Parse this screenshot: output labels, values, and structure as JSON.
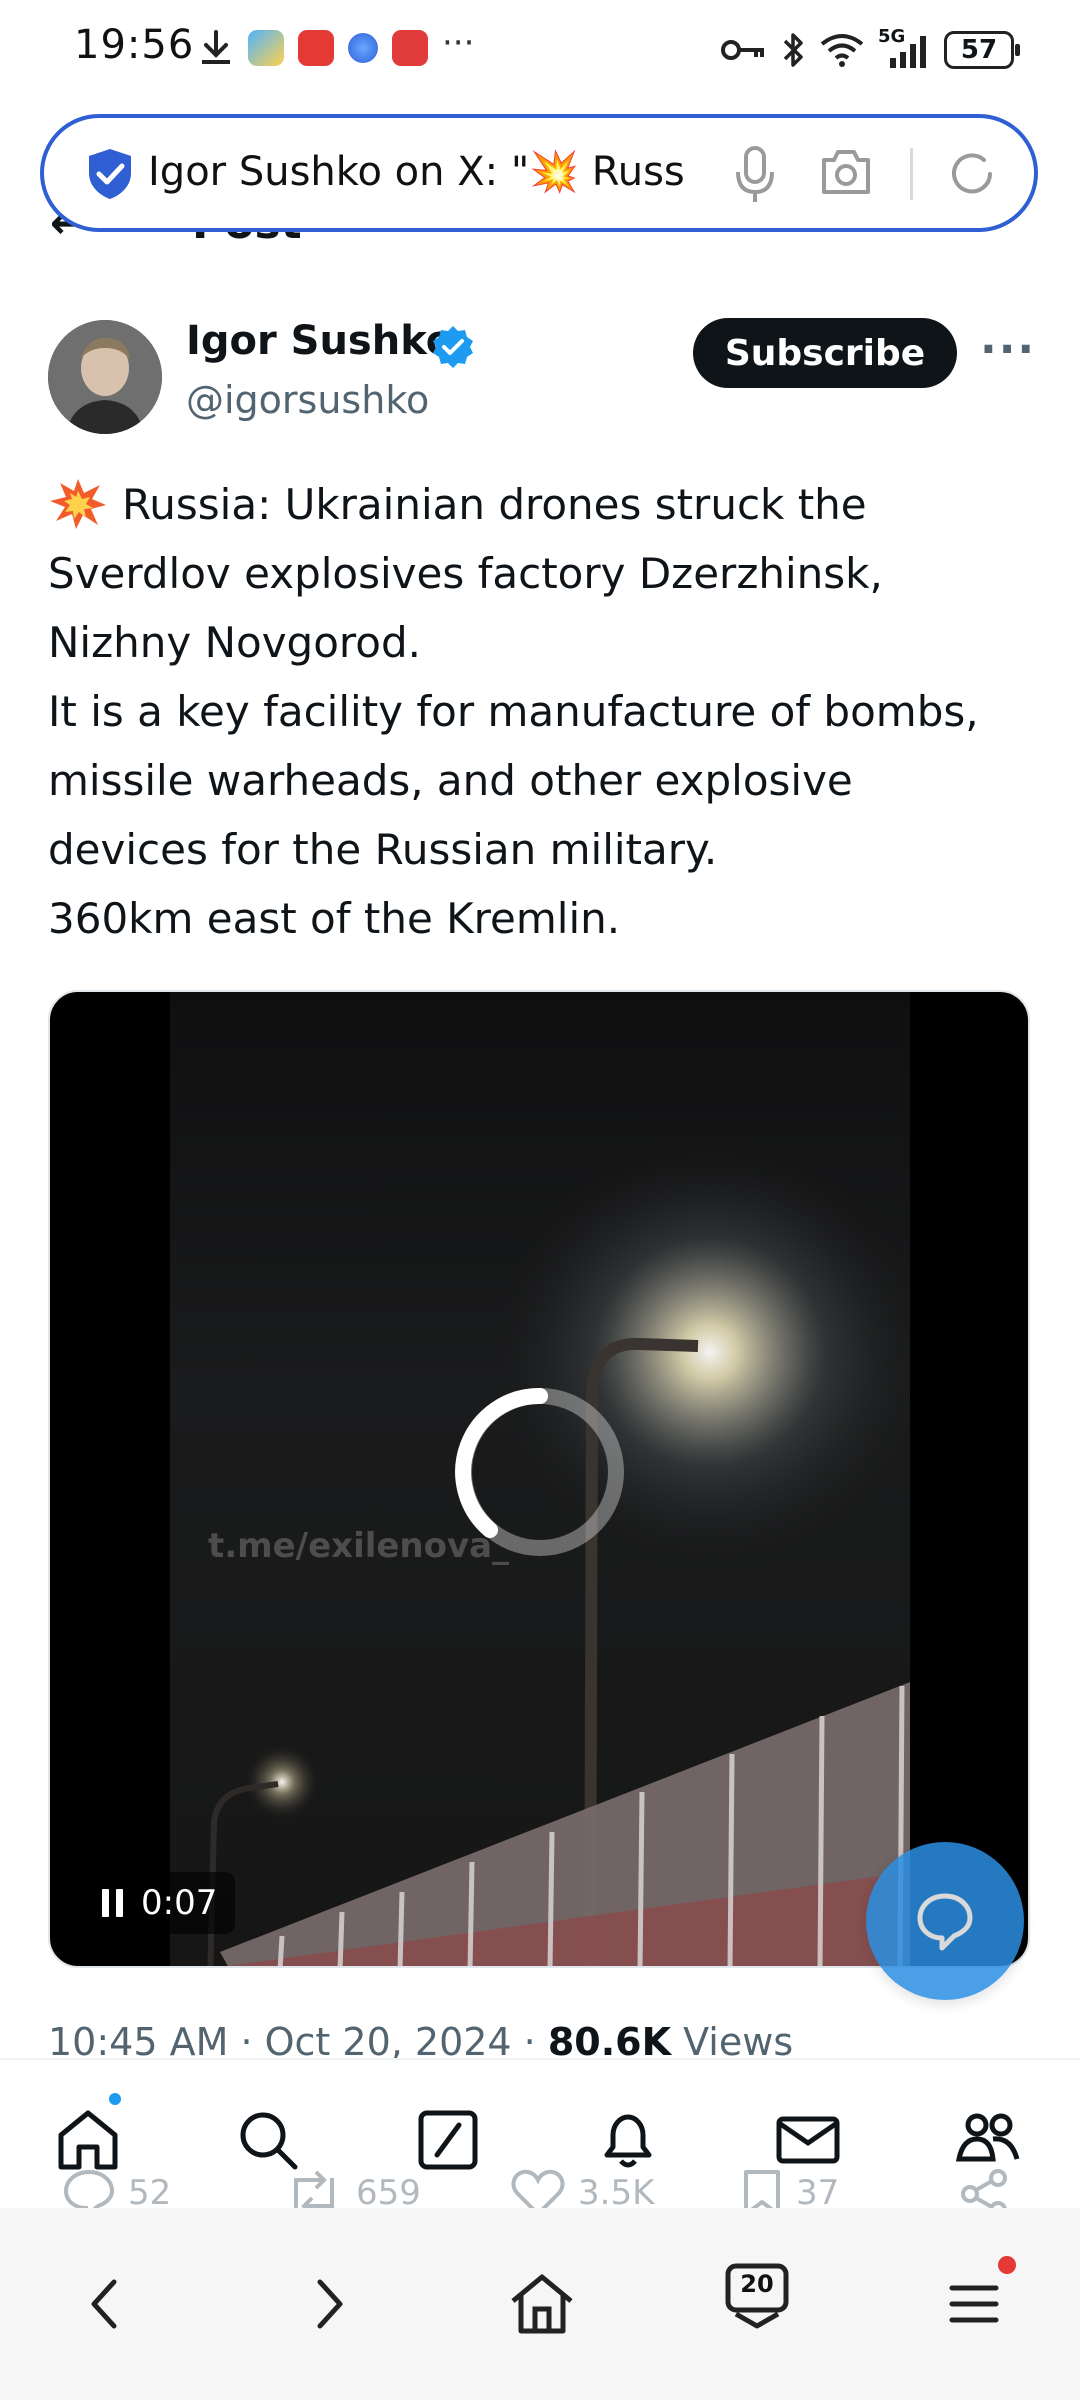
{
  "status_bar": {
    "time": "19:56",
    "network": "5G",
    "battery": "57"
  },
  "url_bar": {
    "text": "Igor Sushko on X: \"💥 Russ"
  },
  "page_header": {
    "title": "Post"
  },
  "author": {
    "name": "Igor Sushko",
    "handle": "@igorsushko",
    "subscribe_label": "Subscribe",
    "more_label": "···"
  },
  "tweet": {
    "lines": [
      "Russia: Ukrainian drones struck the",
      "Sverdlov explosives factory Dzerzhinsk,",
      "Nizhny Novgorod.",
      "It is a key facility for manufacture of bombs,",
      "missile warheads, and other explosive",
      "devices for the Russian military.",
      "360km east of the Kremlin."
    ]
  },
  "video": {
    "watermark": "t.me/exilenova_",
    "time": "0:07"
  },
  "meta": {
    "time_date": "10:45 AM · Oct 20, 2024 · ",
    "views_count": "80.6K",
    "views_label": " Views"
  },
  "actions": {
    "replies": "52",
    "reposts": "659",
    "likes": "3.5K",
    "bookmarks": "37"
  },
  "browser": {
    "tab_count": "20"
  },
  "colors": {
    "accent": "#1d9bf0",
    "url_border": "#2f5fd3",
    "text": "#0f1419",
    "muted": "#536471"
  }
}
